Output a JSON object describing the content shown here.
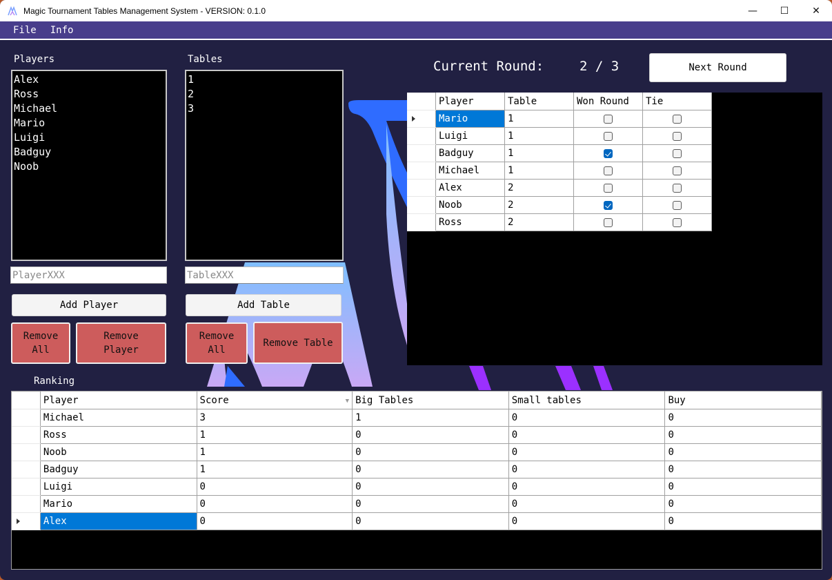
{
  "window": {
    "title": "Magic Tournament Tables Management System - VERSION: 0.1.0",
    "controls": {
      "minimize": "—",
      "maximize": "☐",
      "close": "✕"
    }
  },
  "menu": {
    "items": [
      "File",
      "Info"
    ]
  },
  "players": {
    "label": "Players",
    "items": [
      "Alex",
      "Ross",
      "Michael",
      "Mario",
      "Luigi",
      "Badguy",
      "Noob"
    ],
    "input_placeholder": "PlayerXXX",
    "add_label": "Add Player",
    "remove_all_label": "Remove\nAll",
    "remove_label": "Remove\nPlayer"
  },
  "tables": {
    "label": "Tables",
    "items": [
      "1",
      "2",
      "3"
    ],
    "input_placeholder": "TableXXX",
    "add_label": "Add Table",
    "remove_all_label": "Remove\nAll",
    "remove_label": "Remove Table"
  },
  "round": {
    "label": "Current Round:",
    "value": "2 / 3",
    "current": 2,
    "total": 3,
    "next_label": "Next Round"
  },
  "pairings": {
    "columns": [
      "Player",
      "Table",
      "Won Round",
      "Tie"
    ],
    "selected_row": 0,
    "rows": [
      {
        "player": "Mario",
        "table": "1",
        "won": false,
        "tie": false
      },
      {
        "player": "Luigi",
        "table": "1",
        "won": false,
        "tie": false
      },
      {
        "player": "Badguy",
        "table": "1",
        "won": true,
        "tie": false
      },
      {
        "player": "Michael",
        "table": "1",
        "won": false,
        "tie": false
      },
      {
        "player": "Alex",
        "table": "2",
        "won": false,
        "tie": false
      },
      {
        "player": "Noob",
        "table": "2",
        "won": true,
        "tie": false
      },
      {
        "player": "Ross",
        "table": "2",
        "won": false,
        "tie": false
      }
    ]
  },
  "ranking": {
    "label": "Ranking",
    "columns": [
      "Player",
      "Score",
      "Big Tables",
      "Small tables",
      "Buy"
    ],
    "sort_column": "Score",
    "selected_row": 6,
    "rows": [
      [
        "Michael",
        "3",
        "1",
        "0",
        "0"
      ],
      [
        "Ross",
        "1",
        "0",
        "0",
        "0"
      ],
      [
        "Noob",
        "1",
        "0",
        "0",
        "0"
      ],
      [
        "Badguy",
        "1",
        "0",
        "0",
        "0"
      ],
      [
        "Luigi",
        "0",
        "0",
        "0",
        "0"
      ],
      [
        "Mario",
        "0",
        "0",
        "0",
        "0"
      ],
      [
        "Alex",
        "0",
        "0",
        "0",
        "0"
      ]
    ]
  },
  "colors": {
    "menubar": "#483d8b",
    "background": "#212042",
    "danger_button": "#cd5c5c",
    "selection": "#0078d7",
    "checkbox_on": "#0067c0"
  }
}
